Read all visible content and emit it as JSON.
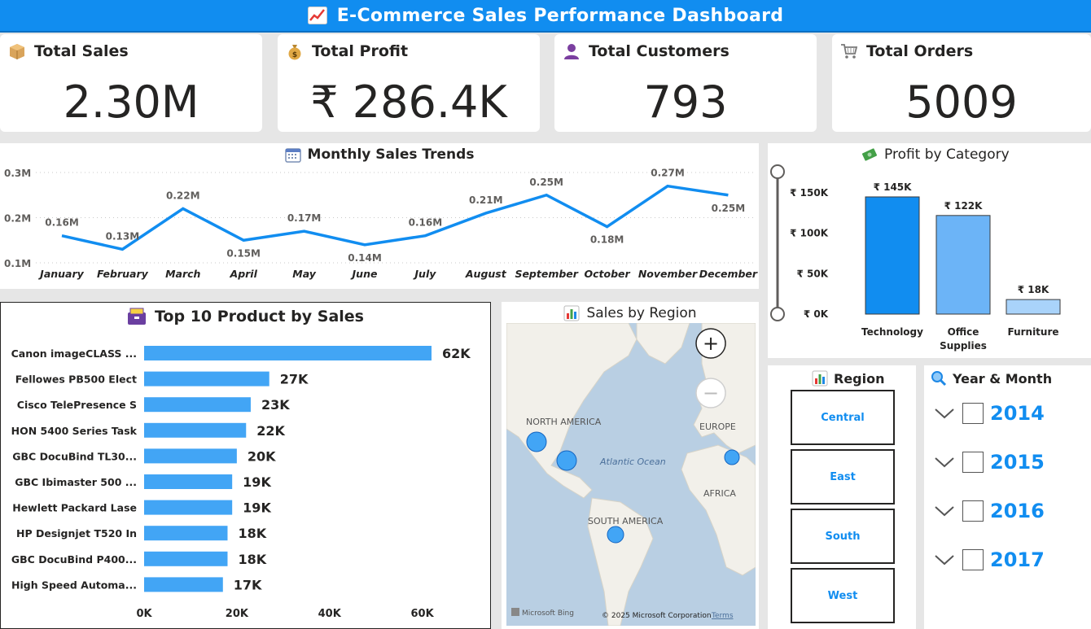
{
  "header": {
    "title": "E-Commerce Sales Performance Dashboard",
    "icon": "chart-increasing-icon"
  },
  "kpis": [
    {
      "label": "Total Sales",
      "value": "2.30M",
      "icon": "package-icon"
    },
    {
      "label": "Total Profit",
      "value": "₹ 286.4K",
      "icon": "money-bag-icon"
    },
    {
      "label": "Total Customers",
      "value": "793",
      "icon": "customer-icon"
    },
    {
      "label": "Total Orders",
      "value": "5009",
      "icon": "shopping-cart-icon"
    }
  ],
  "monthly": {
    "title": "Monthly Sales Trends",
    "icon": "calendar-icon",
    "chart_data": {
      "type": "line",
      "x": [
        "January",
        "February",
        "March",
        "April",
        "May",
        "June",
        "July",
        "August",
        "September",
        "October",
        "November",
        "December"
      ],
      "series": [
        {
          "values": [
            0.16,
            0.13,
            0.22,
            0.15,
            0.17,
            0.14,
            0.16,
            0.21,
            0.25,
            0.18,
            0.27,
            0.25
          ]
        }
      ],
      "labels": [
        "0.16M",
        "0.13M",
        "0.22M",
        "0.15M",
        "0.17M",
        "0.14M",
        "0.16M",
        "0.21M",
        "0.25M",
        "0.18M",
        "0.27M",
        "0.25M"
      ],
      "yticks": [
        "0.1M",
        "0.2M",
        "0.3M"
      ],
      "ylim": [
        0.1,
        0.3
      ],
      "grid": true,
      "color": "#118df0"
    }
  },
  "category": {
    "title": "Profit by Category",
    "icon": "money-icon",
    "chart_data": {
      "type": "bar",
      "categories": [
        "Technology",
        "Office Supplies",
        "Furniture"
      ],
      "values": [
        145,
        122,
        18
      ],
      "labels": [
        "₹ 145K",
        "₹ 122K",
        "₹ 18K"
      ],
      "yticks": [
        "₹ 0K",
        "₹ 50K",
        "₹ 100K",
        "₹ 150K"
      ],
      "ylim": [
        0,
        150
      ],
      "colors": [
        "#118df0",
        "#6cb4f7",
        "#a9d3fa"
      ]
    }
  },
  "products": {
    "title": "Top 10 Product by Sales",
    "icon": "card-file-box-icon",
    "chart_data": {
      "type": "bar",
      "orientation": "horizontal",
      "categories": [
        "Canon imageCLASS ...",
        "Fellowes PB500 Elect",
        "Cisco TelePresence S",
        "HON 5400 Series Task",
        "GBC DocuBind TL30...",
        "GBC Ibimaster 500 ...",
        "Hewlett Packard Lase",
        "HP Designjet T520 In",
        "GBC DocuBind P400...",
        "High Speed Automa..."
      ],
      "values": [
        62,
        27,
        23,
        22,
        20,
        19,
        19,
        18,
        18,
        17
      ],
      "labels": [
        "62K",
        "27K",
        "23K",
        "22K",
        "20K",
        "19K",
        "19K",
        "18K",
        "18K",
        "17K"
      ],
      "xticks": [
        "0K",
        "20K",
        "40K",
        "60K"
      ],
      "xlim": [
        0,
        62
      ],
      "color": "#42a5f5"
    }
  },
  "map": {
    "title": "Sales by Region",
    "icon": "bar-chart-icon",
    "labels": {
      "na": "NORTH AMERICA",
      "eu": "EUROPE",
      "af": "AFRICA",
      "sa": "SOUTH AMERICA",
      "ocean": "Atlantic Ocean"
    },
    "attribution": "© 2025 Microsoft Corporation",
    "terms": "Terms",
    "logo": "Microsoft Bing",
    "zoom_in": "+",
    "zoom_out": "−"
  },
  "region": {
    "title": "Region",
    "icon": "bar-chart-icon",
    "items": [
      "Central",
      "East",
      "South",
      "West"
    ]
  },
  "yearmonth": {
    "title": "Year & Month",
    "icon": "magnifier-icon",
    "years": [
      "2014",
      "2015",
      "2016",
      "2017"
    ]
  }
}
